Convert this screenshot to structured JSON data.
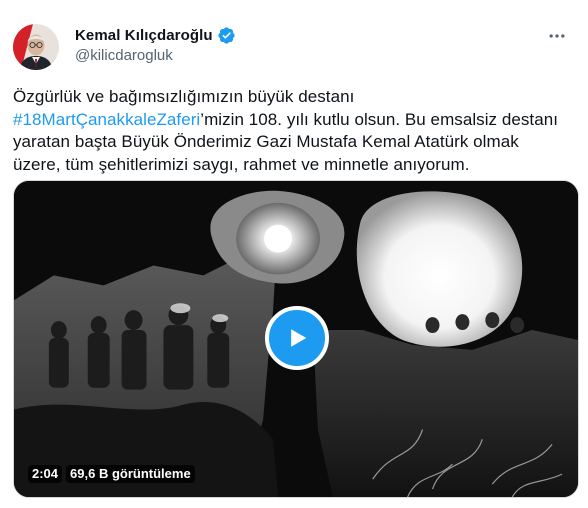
{
  "author": {
    "name": "Kemal Kılıçdaroğlu",
    "handle": "@kilicdarogluk",
    "verified": true,
    "verified_color": "#1d9bf0"
  },
  "tweet": {
    "line1": "Özgürlük ve bağımsızlığımızın büyük destanı",
    "hashtag": "#18MartÇanakkaleZaferi",
    "line2_rest": "’mizin 108. yılı kutlu olsun. Bu emsalsiz destanı",
    "line3": "yaratan başta Büyük Önderimiz Gazi Mustafa Kemal Atatürk olmak",
    "line4": "üzere, tüm şehitlerimizi saygı, rahmet ve minnetle anıyorum."
  },
  "media": {
    "type": "video",
    "duration": "2:04",
    "views": "69,6 B görüntüleme",
    "play_icon": "play-icon",
    "accent": "#1d9bf0"
  },
  "icons": {
    "more": "more-icon",
    "verified": "verified-badge-icon"
  }
}
